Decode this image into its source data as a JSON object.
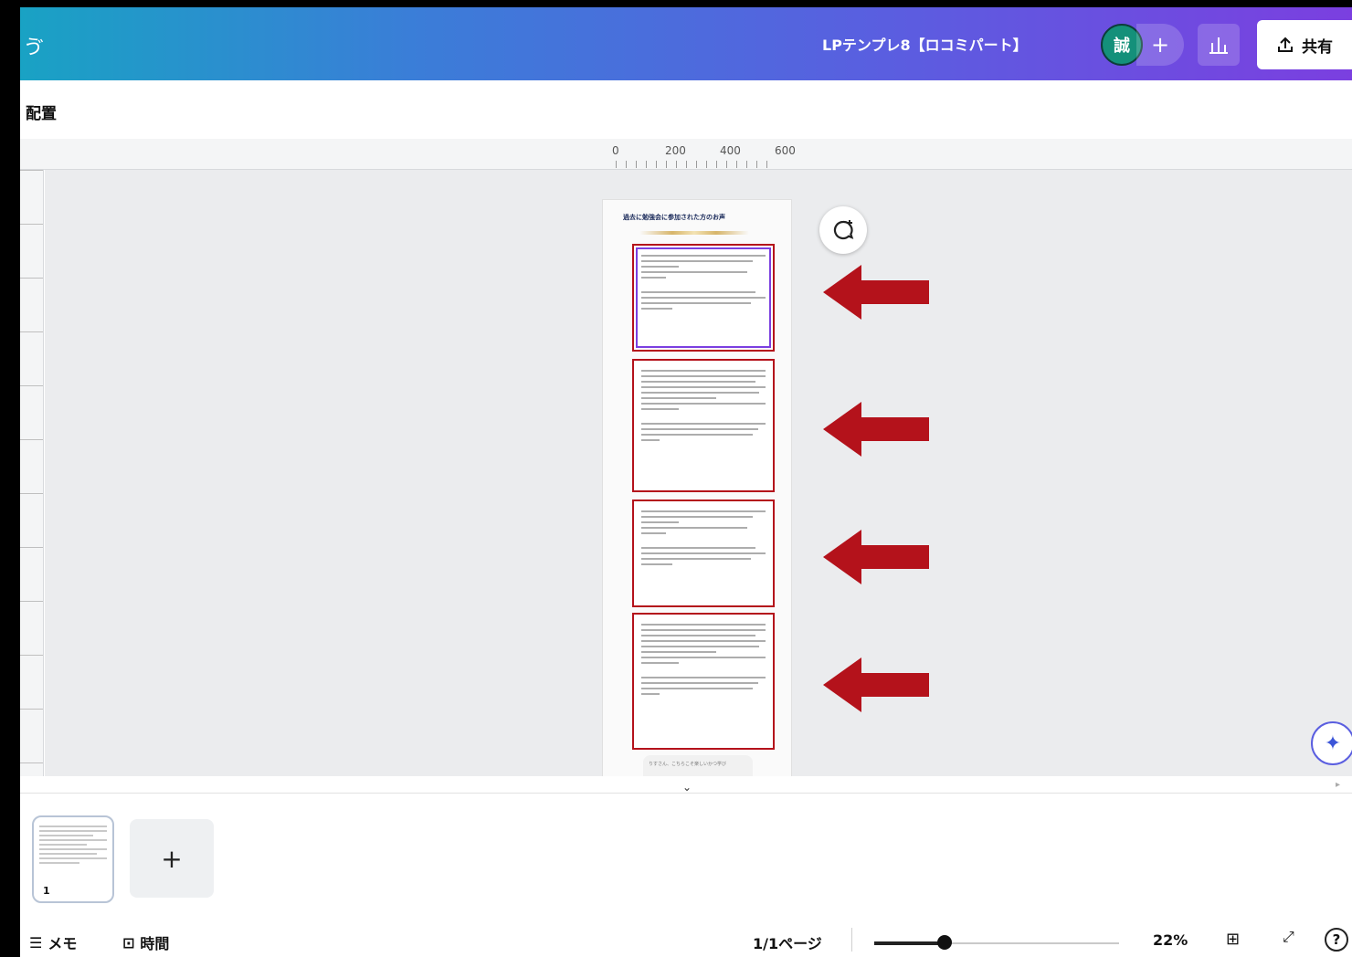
{
  "header": {
    "back_glyph": "ゔ",
    "title": "LPテンプレ8【ロコミパート】",
    "avatar_initial": "誠",
    "add_collaborator_label": "+",
    "insights_icon": "bar-chart-icon",
    "share_label": "共有"
  },
  "toolbar": {
    "position_label": "配置"
  },
  "ruler": {
    "ticks": [
      "0",
      "200",
      "400",
      "600"
    ]
  },
  "canvas": {
    "page_heading": "過去に勉強会に参加された方のお声",
    "tail_text": "りすさん、こちらこそ楽しいかつ学び",
    "annotation_color": "#b4121b",
    "selection_color": "#7b3fe0"
  },
  "pages_panel": {
    "thumb_number": "1",
    "add_page_label": "+"
  },
  "footer": {
    "notes_label": "メモ",
    "timer_label": "時間",
    "page_count": "1/1ページ",
    "zoom_level": "22%",
    "zoom_fraction": 0.22
  }
}
